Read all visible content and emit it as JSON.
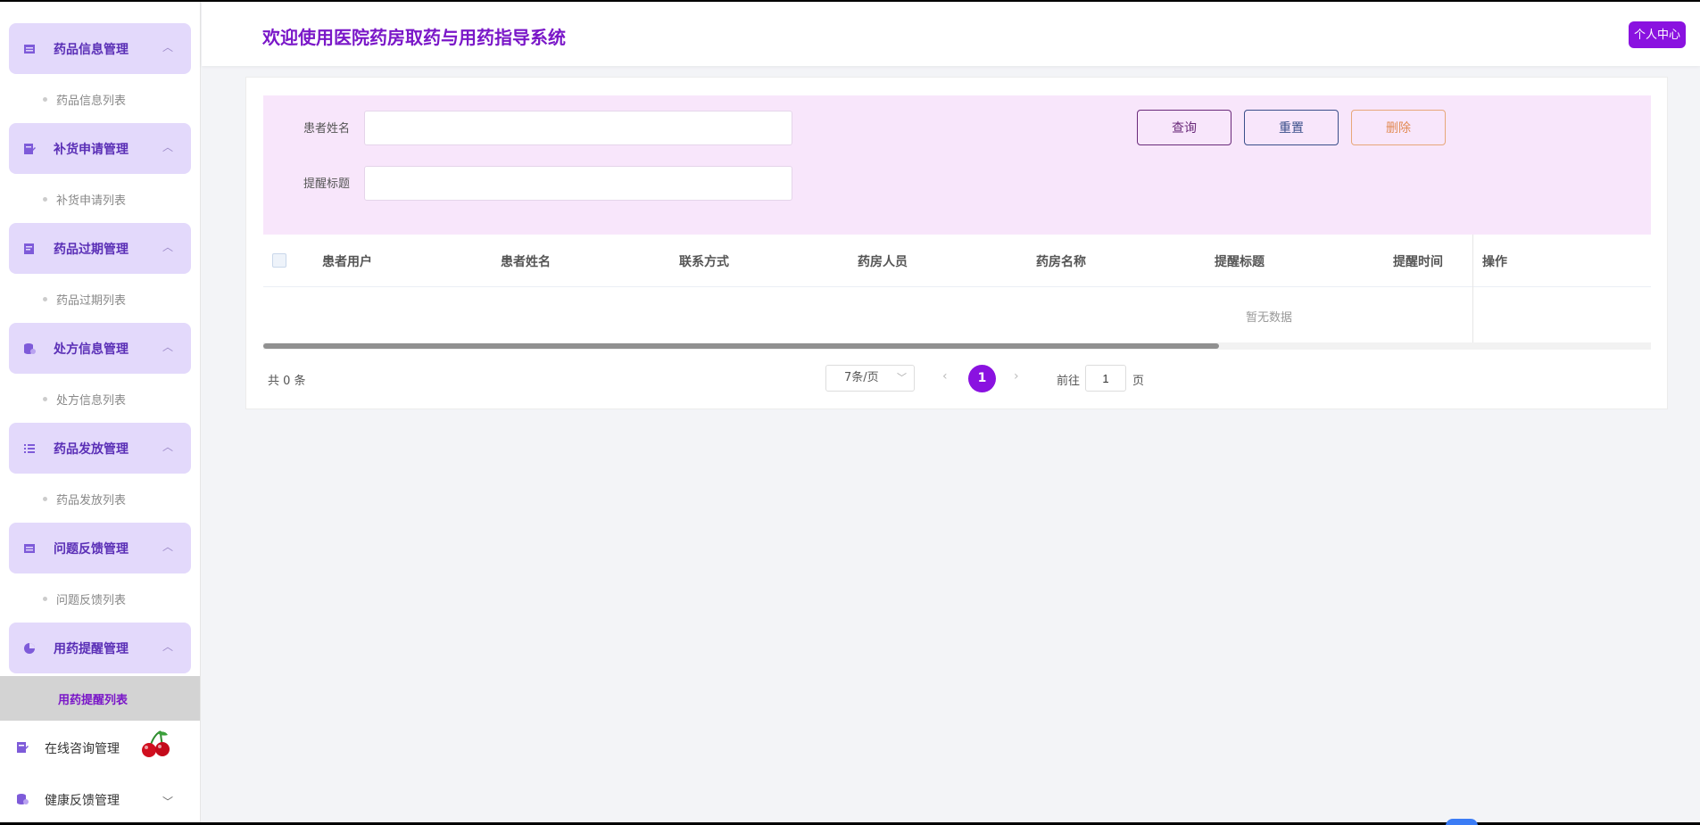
{
  "header": {
    "title": "欢迎使用医院药房取药与用药指导系统",
    "user_center": "个人中心"
  },
  "sidebar": {
    "groups": [
      {
        "label": "药品信息管理",
        "icon": "list-box-icon",
        "child": "药品信息列表"
      },
      {
        "label": "补货申请管理",
        "icon": "edit-doc-icon",
        "child": "补货申请列表"
      },
      {
        "label": "药品过期管理",
        "icon": "doc-icon",
        "child": "药品过期列表"
      },
      {
        "label": "处方信息管理",
        "icon": "database-icon",
        "child": "处方信息列表"
      },
      {
        "label": "药品发放管理",
        "icon": "list-icon",
        "child": "药品发放列表"
      },
      {
        "label": "问题反馈管理",
        "icon": "list-box-icon",
        "child": "问题反馈列表"
      },
      {
        "label": "用药提醒管理",
        "icon": "pie-icon",
        "child": "用药提醒列表"
      }
    ],
    "plain_items": [
      {
        "label": "在线咨询管理",
        "icon": "edit-doc-icon"
      },
      {
        "label": "健康反馈管理",
        "icon": "database-icon"
      }
    ]
  },
  "search": {
    "patient_name_label": "患者姓名",
    "patient_name_value": "",
    "title_label": "提醒标题",
    "title_value": "",
    "query_button": "查询",
    "reset_button": "重置",
    "delete_button": "删除"
  },
  "table": {
    "columns": [
      "患者用户",
      "患者姓名",
      "联系方式",
      "药房人员",
      "药房名称",
      "提醒标题",
      "提醒时间"
    ],
    "action_column": "操作",
    "empty_text": "暂无数据"
  },
  "pagination": {
    "total": "共 0 条",
    "page_size": "7条/页",
    "current_page": "1",
    "goto_label": "前往",
    "goto_value": "1",
    "page_suffix": "页"
  },
  "colors": {
    "accent": "#8a12e0",
    "title": "#7a17c8",
    "menu_bg": "#e3d9fb",
    "search_bg": "#f8e6fb"
  }
}
